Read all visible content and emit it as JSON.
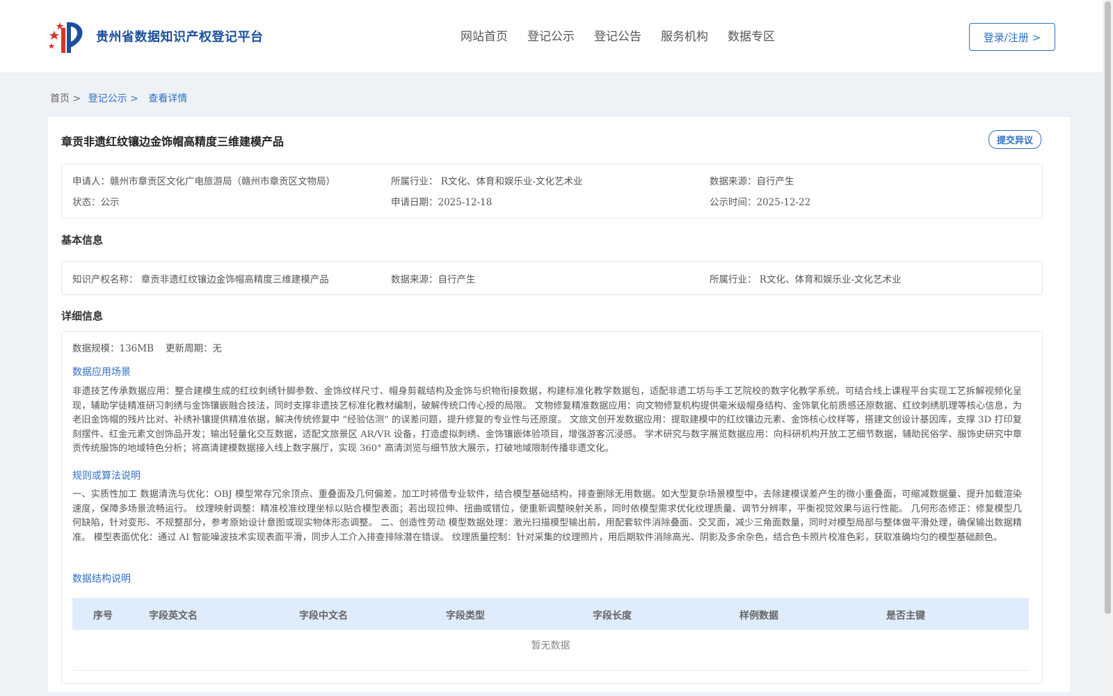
{
  "header": {
    "site_name": "贵州省数据知识产权登记平台",
    "nav": [
      "网站首页",
      "登记公示",
      "登记公告",
      "服务机构",
      "数据专区"
    ],
    "login_label": "登录/注册 >"
  },
  "breadcrumb": {
    "home": "首页 >",
    "list": "登记公示 >",
    "current": "查看详情"
  },
  "detail": {
    "title": "章贡非遗红纹镶边金饰帽高精度三维建模产品",
    "objection_label": "提交异议",
    "summary": {
      "applicant": "申请人：赣州市章贡区文化广电旅游局（赣州市章贡区文物局）",
      "industry": "所属行业：  R文化、体育和娱乐业-文化艺术业",
      "source": "数据来源：自行产生",
      "status": "状态：公示",
      "apply_date": "申请日期：2025-12-18",
      "publish_time": "公示时间：2025-12-22"
    },
    "basic_title": "基本信息",
    "basic": {
      "ip_name": "知识产权名称：  章贡非遗红纹镶边金饰帽高精度三维建模产品",
      "source": "数据来源：自行产生",
      "industry": "所属行业：  R文化、体育和娱乐业-文化艺术业"
    },
    "detail_title": "详细信息",
    "scale": "数据规模：136MB",
    "update_cycle": "更新周期：无",
    "scenario_title": "数据应用场景",
    "scenario_text": "非遗技艺传承数据应用：整合建模生成的红纹刺绣针脚参数、金饰纹样尺寸、帽身剪裁结构及金饰与织物衔接数据，构建标准化教学数据包，适配非遗工坊与手工艺院校的数字化教学系统。可结合线上课程平台实现工艺拆解视频化呈现，辅助学徒精准研习刺绣与金饰镶嵌融合技法，同时支撑非遗技艺标准化教材编制，破解传统口传心授的局限。 文物修复精准数据应用：向文物修复机构提供毫米级帽身结构、金饰氧化前质感还原数据、红纹刺绣肌理等核心信息，为老旧金饰帽的残片比对、补绣补镶提供精准依据，解决传统修复中 “经验估测” 的误差问题，提升修复的专业性与还原度。 文旅文创开发数据应用：提取建模中的红纹镶边元素、金饰核心纹样等，搭建文创设计基因库，支撑 3D 打印复刻摆件、红金元素文创饰品开发；输出轻量化交互数据，适配文旅景区 AR/VR 设备，打造虚拟刺绣、金饰镶嵌体验项目，增强游客沉浸感。 学术研究与数字展览数据应用：向科研机构开放工艺细节数据，辅助民俗学、服饰史研究中章贡传统服饰的地域特色分析；将高清建模数据接入线上数字展厅，实现 360° 高清浏览与细节放大展示，打破地域限制传播非遗文化。",
    "rules_title": "规则或算法说明",
    "rules_text": "一、实质性加工 数据清洗与优化：OBJ 模型常存冗余顶点、重叠面及几何偏差，加工时将借专业软件，结合模型基础结构，排查删除无用数据。如大型复杂场景模型中，去除建模误差产生的微小重叠面，可缩减数据量、提升加载渲染速度，保障多场景流畅运行。 纹理映射调整：精准校准纹理坐标以贴合模型表面；若出现拉伸、扭曲或错位，便重新调整映射关系，同时依模型需求优化纹理质量、调节分辨率，平衡视觉效果与运行性能。 几何形态修正：修复模型几何缺陷，针对变形、不规整部分，参考原始设计意图或现实物体形态调整。 二、创造性劳动 模型数据处理：激光扫描模型输出前，用配套软件消除叠面、交叉面，减少三角面数量，同时对模型局部与整体做平滑处理，确保输出数据精准。 模型表面优化：通过 AI 智能噪波技术实现表面平滑，同步人工介入排查排除潜在错误。 纹理质量控制：针对采集的纹理照片，用后期软件消除高光、阴影及多余杂色，结合色卡照片校准色彩，获取准确均匀的模型基础颜色。",
    "structure_title": "数据结构说明",
    "table_headers": [
      "序号",
      "字段英文名",
      "字段中文名",
      "字段类型",
      "字段长度",
      "样例数据",
      "是否主键"
    ],
    "empty_text": "暂无数据"
  }
}
